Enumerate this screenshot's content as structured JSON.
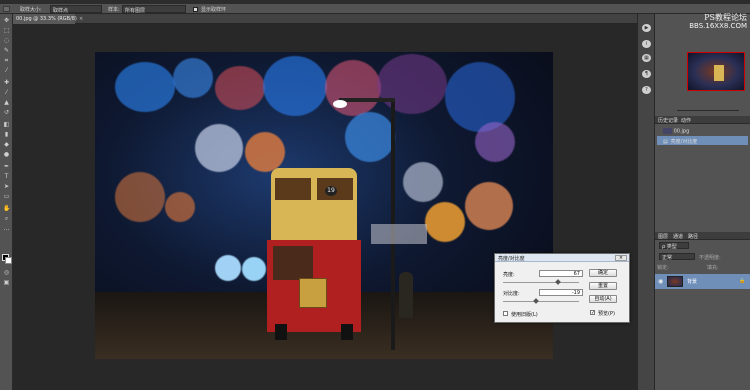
{
  "options_bar": {
    "sample_size_label": "取样大小:",
    "sample_size_value": "取样点",
    "sample_label": "样本:",
    "sample_value": "所有图层",
    "show_ring_label": "显示取样环"
  },
  "document_tab": {
    "title": "00.jpg @ 33.3% (RGB/8)",
    "close_glyph": "×"
  },
  "watermark": {
    "line1": "PS教程论坛",
    "line2": "BBS.16XX8.COM"
  },
  "dialog": {
    "title": "亮度/对比度",
    "close_glyph": "×",
    "brightness_label": "亮度:",
    "brightness_value": "67",
    "contrast_label": "对比度:",
    "contrast_value": "-19",
    "use_legacy_label": "使用旧版(L)",
    "use_legacy_checked": false,
    "ok_label": "确定",
    "cancel_label": "重置",
    "auto_label": "自动(A)",
    "preview_label": "预览(P)",
    "preview_checked": true,
    "brightness_fraction": 0.72,
    "contrast_fraction": 0.44
  },
  "panels": {
    "history_tabs": [
      "历史记录",
      "动作"
    ],
    "history_items": [
      "00.jpg",
      "亮度/对比度"
    ],
    "layers_tabs": [
      "图层",
      "通道",
      "路径"
    ],
    "layers_kind_label": "ρ 类型",
    "blend_mode": "正常",
    "opacity_label": "不透明度:",
    "lock_label": "锁定:",
    "fill_label": "填充:",
    "layer_name": "背景"
  },
  "colors": {
    "ui_dark": "#535353",
    "canvas_bg": "#282828",
    "dialog_bg": "#f0f0f0",
    "highlight": "#6f8fb8"
  }
}
